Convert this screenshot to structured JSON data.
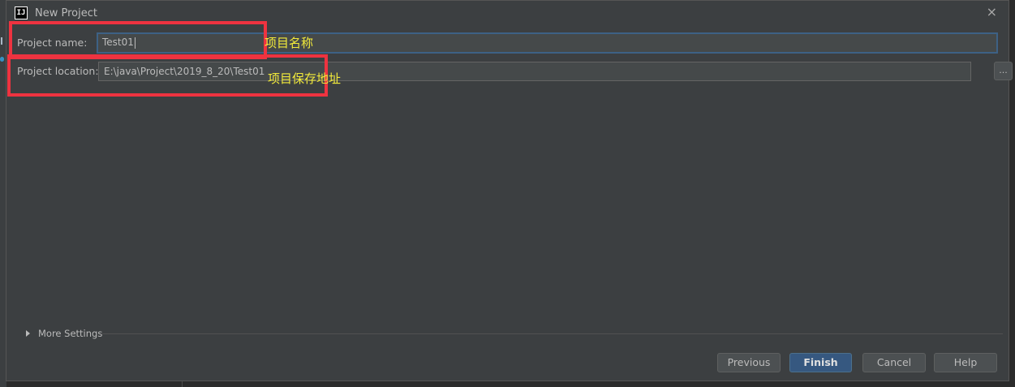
{
  "window": {
    "title": "New Project",
    "icon": "intellij-icon",
    "icon_text": "IJ",
    "close": "×"
  },
  "form": {
    "project_name": {
      "label": "Project name:",
      "value": "Test01"
    },
    "project_location": {
      "label": "Project location:",
      "value": "E:\\java\\Project\\2019_8_20\\Test01",
      "browse_label": "..."
    }
  },
  "annotations": {
    "name_note": "项目名称",
    "location_note": "项目保存地址"
  },
  "more_settings": {
    "label": "More Settings",
    "expanded": false
  },
  "buttons": {
    "previous": "Previous",
    "finish": "Finish",
    "cancel": "Cancel",
    "help": "Help"
  },
  "colors": {
    "annotation_box": "#ee3340",
    "annotation_text": "#f2ea3a",
    "focus": "#3d6185",
    "primary_button": "#365880"
  }
}
